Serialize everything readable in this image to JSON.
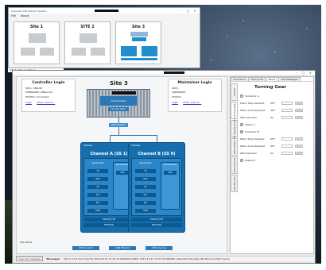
{
  "overview": {
    "title": "Channel OTM Monitor System",
    "menu": [
      "File",
      "About"
    ],
    "sites": [
      {
        "name": "Site 1",
        "active": false
      },
      {
        "name": "SITE 2",
        "active": false
      },
      {
        "name": "Site 3",
        "active": true
      }
    ]
  },
  "taskbar": {
    "label": "Site 1 | Site 2 | Site 3"
  },
  "main": {
    "site_title": "Site 3",
    "controller_login": {
      "title": "Controller Login",
      "lines": [
        "ID(R): CNR-08",
        "USERNAME: CNRA1-00",
        "STATUS: Connected"
      ],
      "login": "Login",
      "other": "Other actions..."
    },
    "maintainer_login": {
      "title": "Maintainer Login",
      "lines": [
        "ID(R):",
        "USERNAME:",
        "STATUS:"
      ],
      "login": "Login",
      "other": "Other actions..."
    },
    "hw": {
      "core": "Turning Gear",
      "core2": "Tuning Gear",
      "dd": "DBD-Master"
    },
    "channels": [
      {
        "mini": "Softrates",
        "name": "Channel A (SS 1)",
        "mods_header": "Sensitivator",
        "mods": [
          "TS",
          "RSC",
          "VE",
          "SCT",
          "SLT",
          "TDM"
        ],
        "side_title": "Channel Mod",
        "side": "SSS",
        "foot1": "DDR B(F) RP",
        "foot2": "TBUS(SS)"
      },
      {
        "mini": "Softrates",
        "name": "Channel B (SS 9)",
        "mods_header": "Sensitivator",
        "mods": [
          "TS",
          "RSC",
          "VE",
          "SCT",
          "SLT",
          "TDM"
        ],
        "side_title": "Channel Mod",
        "side": "SSS",
        "foot1": "DDR B(F) RP",
        "foot2": "TBUS(SS)"
      }
    ],
    "site_items": "Site Items:",
    "bottom_buttons": [
      "UPS Invertor",
      "GNB Monitor",
      "UPS Devices"
    ]
  },
  "right": {
    "tabs": [
      "Channel A",
      "Channel B",
      "Site 3",
      "Site Messages"
    ],
    "vtabs": [
      "Actions",
      "Turning Gear",
      "RF Supply Driver",
      "QPS Actions",
      "Site Devices",
      "Site Monitor"
    ],
    "title": "Turning Gear",
    "rows": [
      {
        "type": "group",
        "text": "Contactor A"
      },
      {
        "type": "row",
        "label": "Motor Stop Selected",
        "val": "OFF"
      },
      {
        "type": "row",
        "label": "Motor Local Selected",
        "val": "OFF"
      },
      {
        "type": "row",
        "label": "SDG Selected",
        "val": "On"
      },
      {
        "type": "group",
        "text": "Status A"
      },
      {
        "type": "group",
        "text": "Contactor B"
      },
      {
        "type": "row",
        "label": "Motor Stop Selected",
        "val": "OFF"
      },
      {
        "type": "row",
        "label": "Motor Local Selected",
        "val": "OFF"
      },
      {
        "type": "row",
        "label": "SDG Selected",
        "val": "On"
      },
      {
        "type": "group",
        "text": "Status B"
      }
    ],
    "send_label": "Send"
  },
  "messages": {
    "clear_btn": "Clear all messages",
    "label": "Messages:",
    "text": "Site 3 out 8 are 8 alarms 2019-02-27 17:29:14.000000 ALARM: 2019-12-27 13:27:40.000000 | Reported Recently (No Disconnected Users)"
  }
}
